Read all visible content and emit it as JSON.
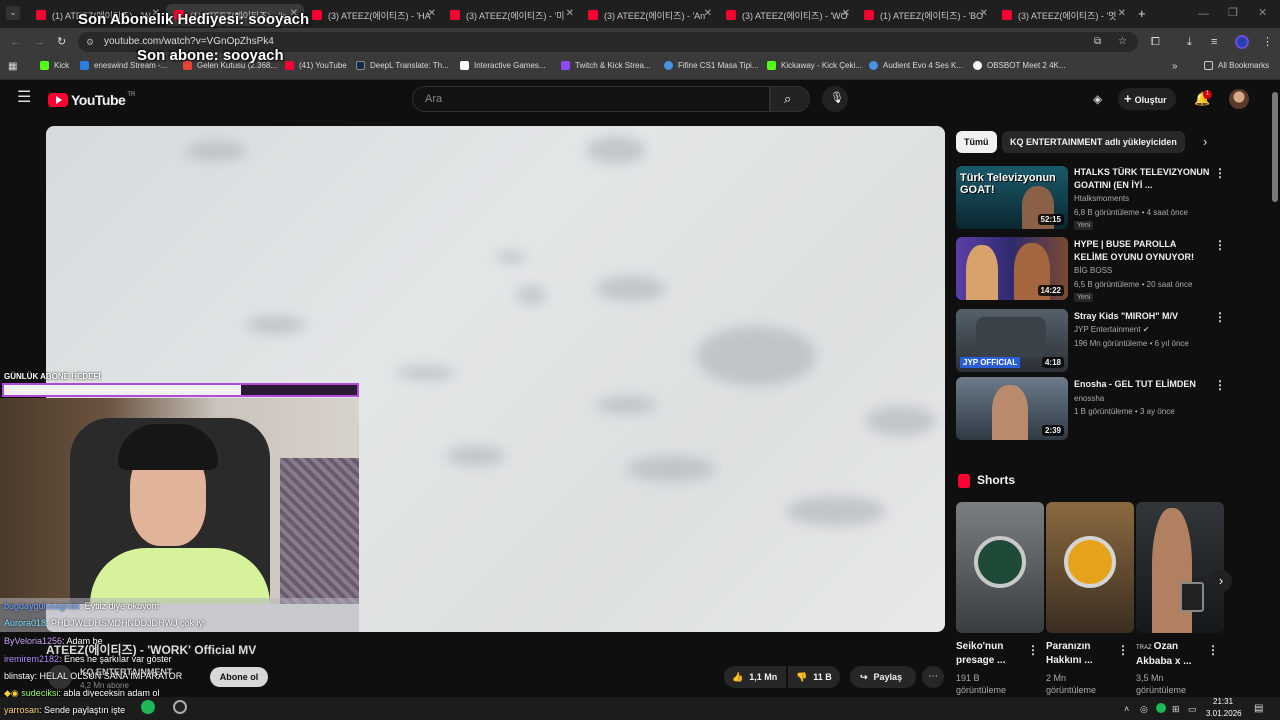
{
  "tabs": [
    {
      "label": "(1) ATEEZ(에이티즈) - 'W"
    },
    {
      "label": "(1) ATEEZ(에이티즈) - 'Ic"
    },
    {
      "label": "(3) ATEEZ(에이티즈) - 'HA"
    },
    {
      "label": "(3) ATEEZ(에이티즈) - '미"
    },
    {
      "label": "(3) ATEEZ(에이티즈) - 'An"
    },
    {
      "label": "(3) ATEEZ(에이티즈) - 'WO"
    },
    {
      "label": "(1) ATEEZ(에이티즈) - 'BO"
    },
    {
      "label": "(3) ATEEZ(에이티즈) - '멋"
    }
  ],
  "address": {
    "url": "youtube.com/watch?v=VGnOpZhsPk4"
  },
  "bookmarks": [
    {
      "label": "Kick",
      "color": "#53fc18"
    },
    {
      "label": "eneswind Stream -...",
      "color": "#2a7de1"
    },
    {
      "label": "Gelen Kutusu (2.368...",
      "color": "#ea4335"
    },
    {
      "label": "(41) YouTube",
      "color": "#ff0033"
    },
    {
      "label": "DeepL Translate: Th...",
      "color": "#0f2b46"
    },
    {
      "label": "Interactive Games...",
      "color": "#ffffff"
    },
    {
      "label": "Twitch & Kick Strea...",
      "color": "#9146ff"
    },
    {
      "label": "Fifine CS1 Masa Tipi...",
      "color": "#4a90e2"
    },
    {
      "label": "Kickaway - Kick Çeki...",
      "color": "#53fc18"
    },
    {
      "label": "Audient Evo 4 Ses K...",
      "color": "#4a90e2"
    },
    {
      "label": "OBSBOT Meet 2 4K...",
      "color": "#ffffff"
    }
  ],
  "all_bookmarks": "All Bookmarks",
  "youtube": {
    "logo_text": "YouTube",
    "logo_sup": "TR",
    "search_placeholder": "Ara",
    "create_label": "Oluştur",
    "notif_count": "1"
  },
  "video": {
    "title": "ATEEZ(에이티즈) - 'WORK' Official MV",
    "channel": "KQ ENTERTAINMENT",
    "subs": "4,2 Mn abone",
    "subscribe_label": "Abone ol",
    "likes": "1,1 Mn",
    "dislike_label": "11 B",
    "share_label": "Paylaş"
  },
  "chips": [
    "Tümü",
    "KQ ENTERTAINMENT adlı yükleyiciden"
  ],
  "sidebar_videos": [
    {
      "title": "HTALKS TÜRK TELEVIZYONUN GOATINI (EN İYİ ...",
      "channel": "Htalksmoments",
      "meta": "6,8 B görüntüleme • 4 saat önce",
      "duration": "52:15",
      "badge": "Yeni",
      "thumb_text": "Türk Televizyonun GOAT!"
    },
    {
      "title": "HYPE | BUSE PAROLLA KELİME OYUNU OYNUYOR!",
      "channel": "BİG BOSS",
      "meta": "6,5 B görüntüleme • 20 saat önce",
      "duration": "14:22",
      "badge": "Yeni"
    },
    {
      "title": "Stray Kids \"MIROH\" M/V",
      "channel": "JYP Entertainment",
      "meta": "196 Mn görüntüleme • 6 yıl önce",
      "duration": "4:18",
      "badge": "",
      "thumb_text": "JYP OFFICIAL"
    },
    {
      "title": "Enosha - GEL TUT ELİMDEN",
      "channel": "enossha",
      "meta": "1 B görüntüleme • 3 ay önce",
      "duration": "2:39",
      "badge": ""
    }
  ],
  "shorts": {
    "heading": "Shorts",
    "items": [
      {
        "title": "Seiko'nun presage ...",
        "meta": "191 B görüntüleme"
      },
      {
        "title": "Paranızın Hakkını ...",
        "meta": "2 Mn görüntüleme"
      },
      {
        "title": "Ozan Akbaba x ...",
        "meta": "3,5 Mn görüntüleme",
        "prefix": "TRAZ"
      }
    ]
  },
  "stream_overlay": {
    "last_gift": "Son Abonelik Hediyesi: sooyach",
    "last_sub": "Son abone: sooyach",
    "goal_label": "GÜNLÜK ABONE HEDEFİ",
    "goal_count": "2 / 3",
    "goal_progress": 0.67
  },
  "chat": [
    {
      "user": "bugdaygulusagnak",
      "msg": ": Eytiiz diye okuyom",
      "color": "#6fa8ff"
    },
    {
      "user": "Aurora018",
      "msg": ": PHDJWLDHSMDHNDDJDHWJ çok iyi",
      "color": "#7fe0ff"
    },
    {
      "user": "ByVeloria1256",
      "msg": ": Adam be",
      "color": "#c9a8ff"
    },
    {
      "user": "iremirem2182",
      "msg": ": Enes ne şarkılar var göster",
      "color": "#b08cff"
    },
    {
      "user": "blinstay",
      "msg": ": HELAL OLSUN SANA İMPARATOR",
      "color": "#ffffff"
    },
    {
      "user": "sudeciksi",
      "msg": ": abla diyeceksin adam ol",
      "color": "#9cff6b"
    },
    {
      "user": "yarrosan",
      "msg": ": Sende paylaştın işte",
      "color": "#ffd27a"
    }
  ],
  "taskbar": {
    "time": "21:31",
    "date": "3.01.2026"
  }
}
